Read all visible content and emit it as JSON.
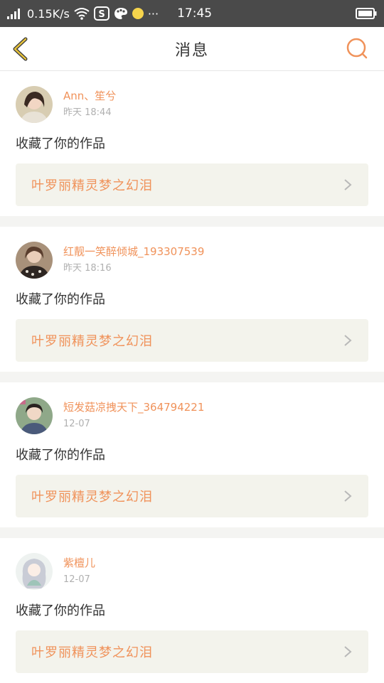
{
  "status_bar": {
    "net_speed": "0.15K/s",
    "ellipsis": "···",
    "time": "17:45",
    "icons": [
      "signal-icon",
      "wifi-icon",
      "s-app-icon",
      "palette-icon",
      "yellow-dot-icon",
      "battery-icon"
    ]
  },
  "header": {
    "title": "消息",
    "back_icon": "chevron-left-icon",
    "search_icon": "search-icon"
  },
  "colors": {
    "accent": "#f0925a",
    "back_yellow": "#e6c23a",
    "status_bar_bg": "#4a4a4a",
    "card_link_bg": "#f3f3ec"
  },
  "messages": [
    {
      "name": "Ann、笙兮",
      "time": "昨天 18:44",
      "text": "收藏了你的作品",
      "work_title": "叶罗丽精灵梦之幻泪"
    },
    {
      "name": "红靓一笑醉倾城_193307539",
      "time": "昨天 18:16",
      "text": "收藏了你的作品",
      "work_title": "叶罗丽精灵梦之幻泪"
    },
    {
      "name": "短发菇凉拽天下_364794221",
      "time": "12-07",
      "text": "收藏了你的作品",
      "work_title": "叶罗丽精灵梦之幻泪"
    },
    {
      "name": "紫檀儿",
      "time": "12-07",
      "text": "收藏了你的作品",
      "work_title": "叶罗丽精灵梦之幻泪"
    }
  ]
}
